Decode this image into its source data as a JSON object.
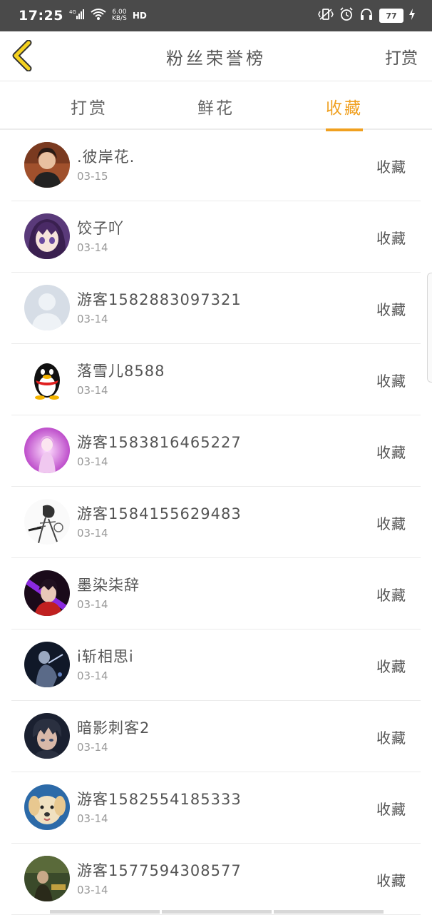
{
  "status_bar": {
    "time": "17:25",
    "network": "4G",
    "speed_value": "6.00",
    "speed_unit": "KB/S",
    "hd": "HD",
    "battery": "77"
  },
  "header": {
    "title": "粉丝荣誉榜",
    "right_action": "打赏"
  },
  "tabs": [
    {
      "label": "打赏",
      "active": false
    },
    {
      "label": "鲜花",
      "active": false
    },
    {
      "label": "收藏",
      "active": true
    }
  ],
  "accent_color": "#f0a020",
  "fans": [
    {
      "name": ".彼岸花.",
      "date": "03-15",
      "action": "收藏",
      "avatar": "woman-photo"
    },
    {
      "name": "饺子吖",
      "date": "03-14",
      "action": "收藏",
      "avatar": "anime-girl"
    },
    {
      "name": "游客1582883097321",
      "date": "03-14",
      "action": "收藏",
      "avatar": "default-user"
    },
    {
      "name": "落雪儿8588",
      "date": "03-14",
      "action": "收藏",
      "avatar": "qq-penguin"
    },
    {
      "name": "游客1583816465227",
      "date": "03-14",
      "action": "收藏",
      "avatar": "purple-anime"
    },
    {
      "name": "游客1584155629483",
      "date": "03-14",
      "action": "收藏",
      "avatar": "sketch-figure"
    },
    {
      "name": "墨染柒辞",
      "date": "03-14",
      "action": "收藏",
      "avatar": "dark-warrior"
    },
    {
      "name": "i斩相思i",
      "date": "03-14",
      "action": "收藏",
      "avatar": "dark-fighter"
    },
    {
      "name": "暗影刺客2",
      "date": "03-14",
      "action": "收藏",
      "avatar": "dark-anime-boy"
    },
    {
      "name": "游客1582554185333",
      "date": "03-14",
      "action": "收藏",
      "avatar": "puppy"
    },
    {
      "name": "游客1577594308577",
      "date": "03-14",
      "action": "收藏",
      "avatar": "green-scene"
    }
  ]
}
